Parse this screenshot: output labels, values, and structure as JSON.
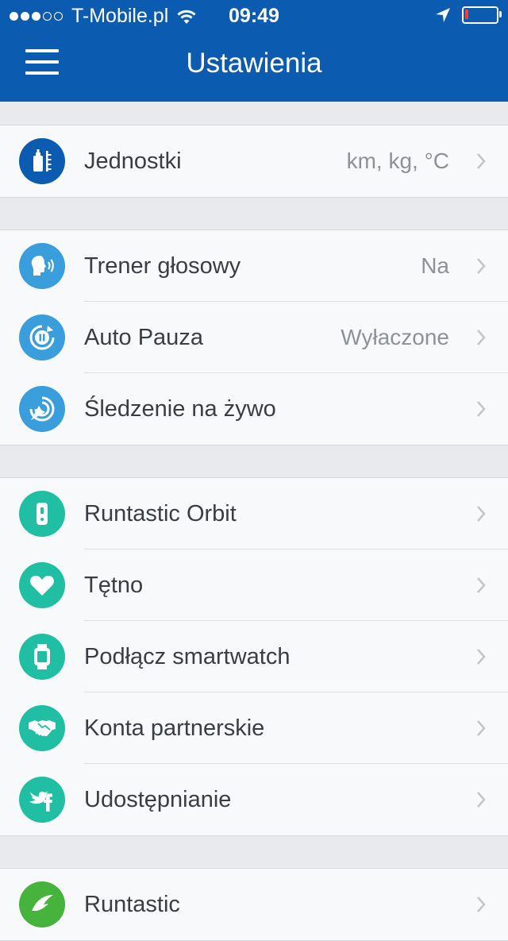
{
  "status_bar": {
    "carrier": "T-Mobile.pl",
    "time": "09:49",
    "signal_bars_filled": 3,
    "signal_bars_total": 5,
    "battery_level": 0.1
  },
  "header": {
    "title": "Ustawienia",
    "color": "#0b5cb0"
  },
  "colors": {
    "icon_dark_blue": "#0b5cb0",
    "icon_blue": "#3a9edd",
    "icon_teal": "#20bfa3",
    "icon_green": "#46b43c"
  },
  "groups": [
    {
      "items": [
        {
          "icon": "units-icon",
          "label": "Jednostki",
          "value": "km, kg, °C"
        }
      ]
    },
    {
      "items": [
        {
          "icon": "voice-coach-icon",
          "label": "Trener głosowy",
          "value": "Na"
        },
        {
          "icon": "auto-pause-icon",
          "label": "Auto Pauza",
          "value": "Wyłaczone"
        },
        {
          "icon": "live-tracking-icon",
          "label": "Śledzenie na żywo",
          "value": ""
        }
      ]
    },
    {
      "items": [
        {
          "icon": "orbit-icon",
          "label": "Runtastic Orbit",
          "value": ""
        },
        {
          "icon": "heart-icon",
          "label": "Tętno",
          "value": ""
        },
        {
          "icon": "smartwatch-icon",
          "label": "Podłącz smartwatch",
          "value": ""
        },
        {
          "icon": "handshake-icon",
          "label": "Konta partnerskie",
          "value": ""
        },
        {
          "icon": "social-share-icon",
          "label": "Udostępnianie",
          "value": ""
        }
      ]
    },
    {
      "items": [
        {
          "icon": "runtastic-logo-icon",
          "label": "Runtastic",
          "value": ""
        }
      ]
    }
  ]
}
